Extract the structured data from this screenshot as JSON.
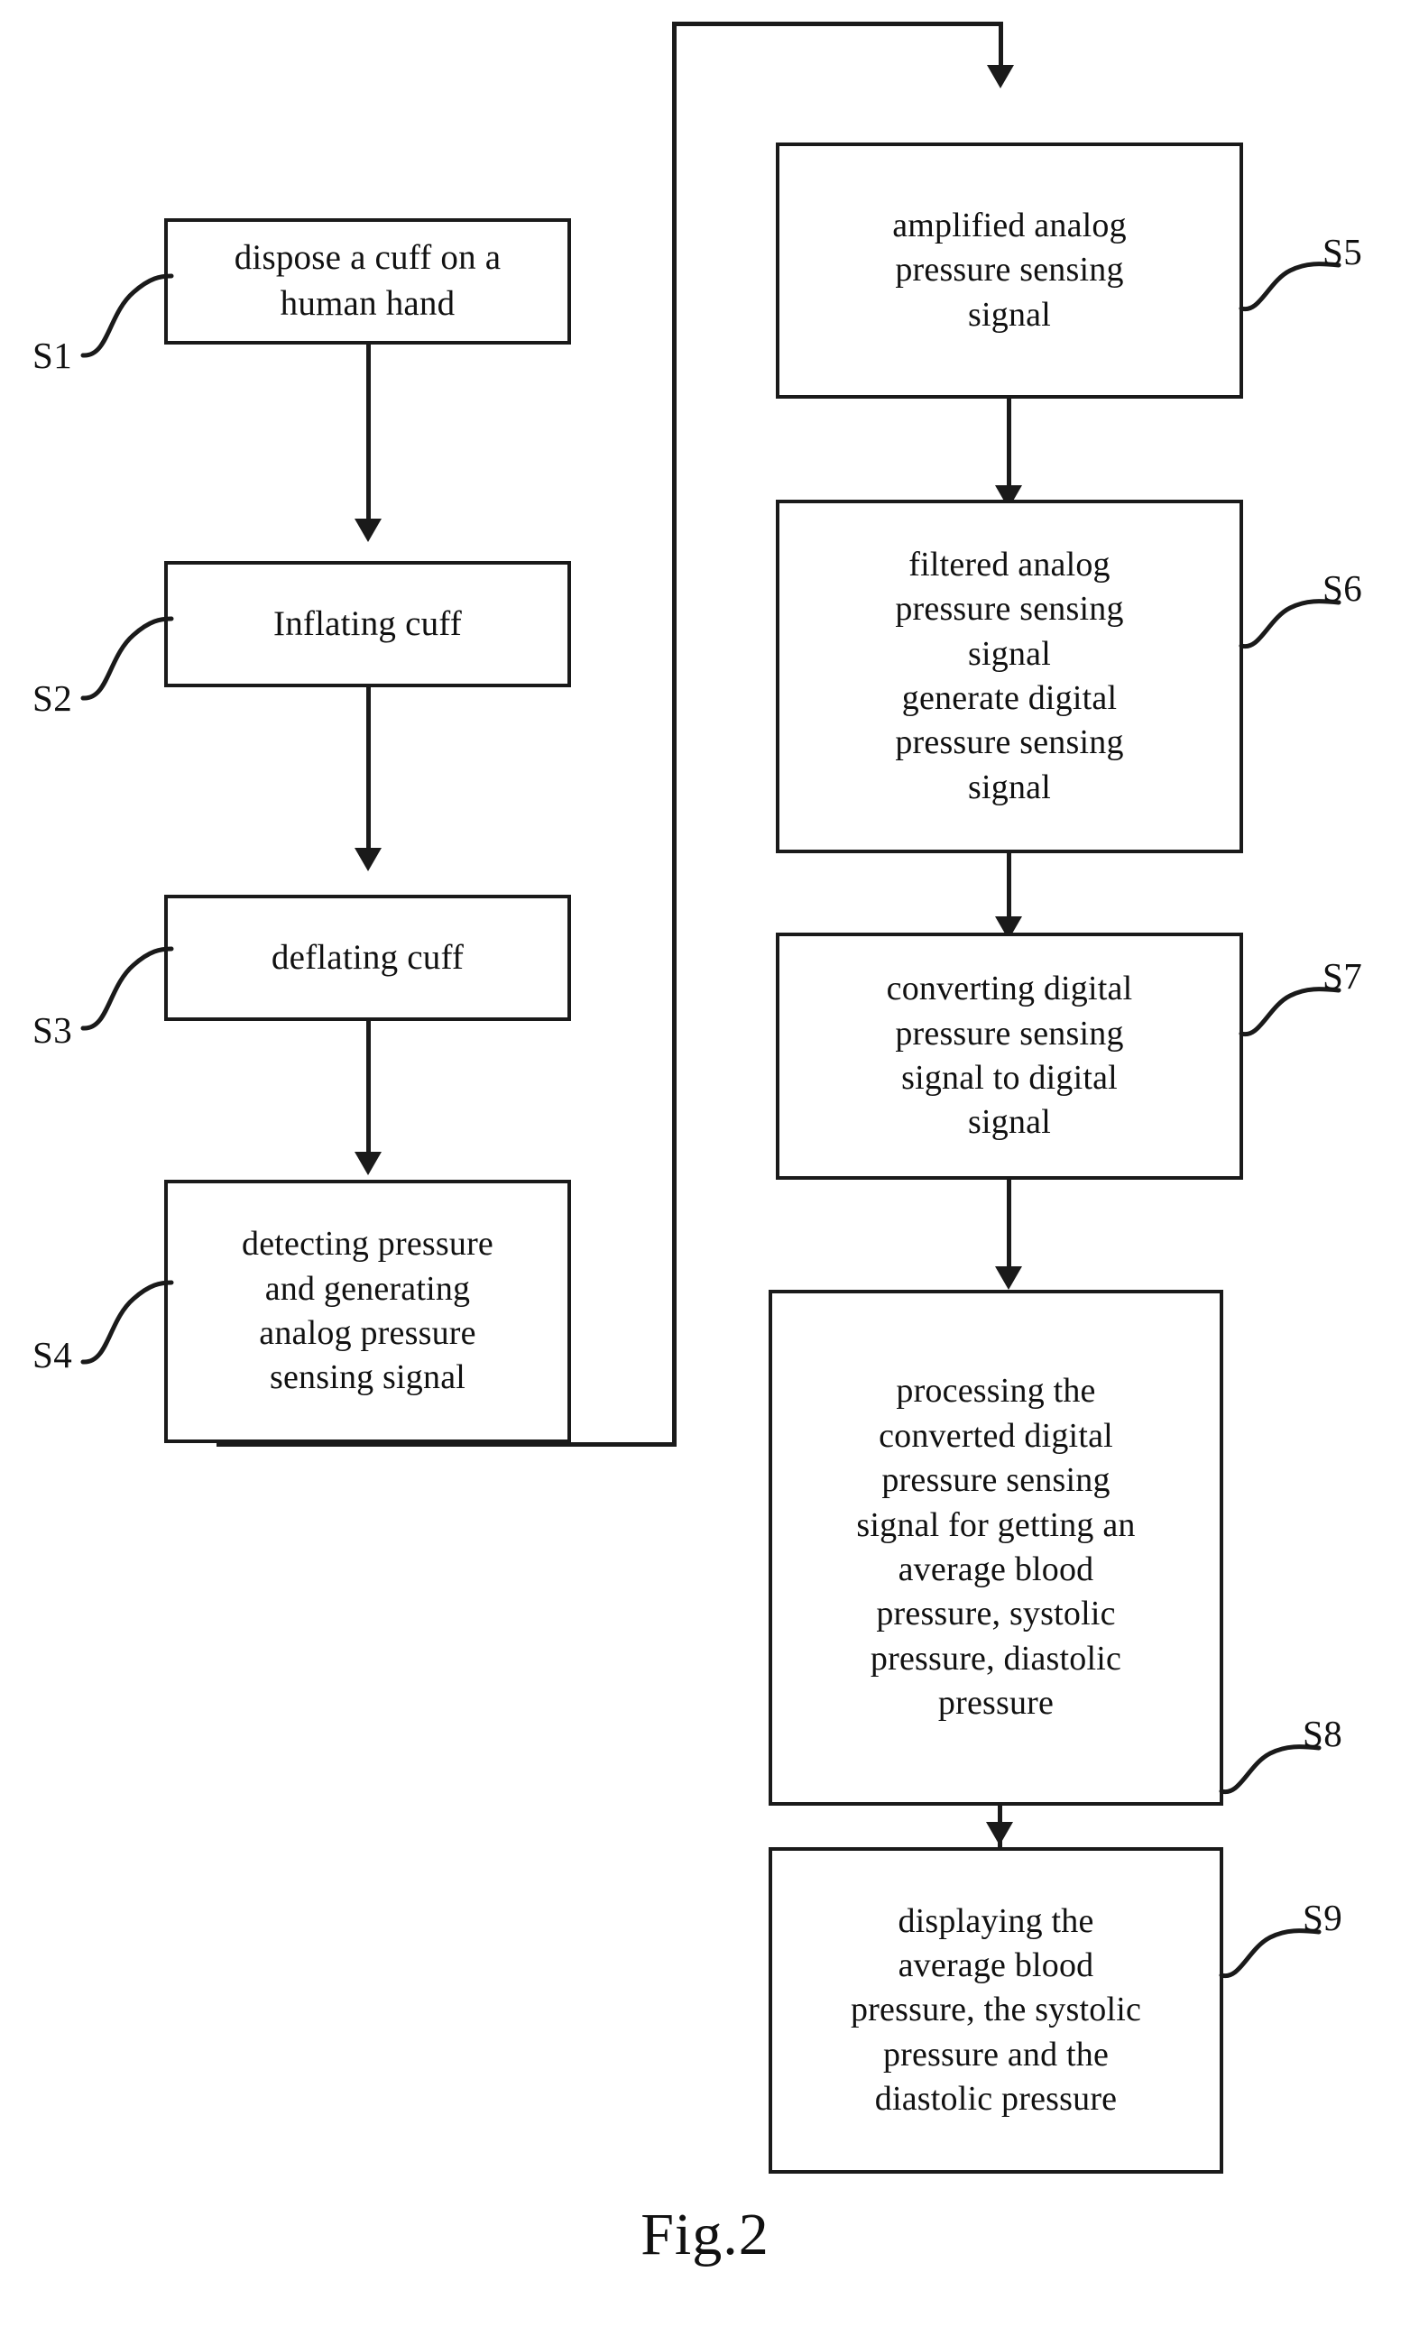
{
  "figure": {
    "caption": "Fig.2",
    "type": "patent-flowchart"
  },
  "chart_data": {
    "type": "diagram",
    "title": "Fig.2",
    "layout": "two-column flowchart with feedback loop",
    "nodes": [
      {
        "id": "S1",
        "label": "S1",
        "text": "dispose a cuff  on a\nhuman hand",
        "column": "left"
      },
      {
        "id": "S2",
        "label": "S2",
        "text": "Inflating cuff",
        "column": "left"
      },
      {
        "id": "S3",
        "label": "S3",
        "text": "deflating cuff",
        "column": "left"
      },
      {
        "id": "S4",
        "label": "S4",
        "text": "detecting  pressure\nand generating\nanalog pressure\nsensing signal",
        "column": "left"
      },
      {
        "id": "S5",
        "label": "S5",
        "text": "amplified analog\npressure sensing\nsignal",
        "column": "right"
      },
      {
        "id": "S6",
        "label": "S6",
        "text": "filtered analog\npressure sensing\nsignal\ngenerate digital\npressure sensing\nsignal",
        "column": "right"
      },
      {
        "id": "S7",
        "label": "S7",
        "text": "converting  digital\npressure sensing\nsignal  to  digital\nsignal",
        "column": "right"
      },
      {
        "id": "S8",
        "label": "S8",
        "text": "processing the\nconverted digital\npressure sensing\nsignal  for getting an\naverage blood\npressure, systolic\npressure, diastolic\npressure",
        "column": "right"
      },
      {
        "id": "S9",
        "label": "S9",
        "text": "displaying the\naverage blood\npressure, the systolic\npressure and the\ndiastolic pressure",
        "column": "right"
      }
    ],
    "edges": [
      {
        "from": "S1",
        "to": "S2",
        "style": "arrow"
      },
      {
        "from": "S2",
        "to": "S3",
        "style": "arrow"
      },
      {
        "from": "S3",
        "to": "S4",
        "style": "arrow"
      },
      {
        "from": "S4",
        "to": "S5",
        "style": "routed-arrow"
      },
      {
        "from": "S5",
        "to": "S6",
        "style": "arrow"
      },
      {
        "from": "S6",
        "to": "S7",
        "style": "arrow"
      },
      {
        "from": "S7",
        "to": "S8",
        "style": "arrow"
      },
      {
        "from": "S8",
        "to": "S9",
        "style": "arrow"
      }
    ],
    "colors": {
      "stroke": "#1a1a1a",
      "background": "#ffffff",
      "text": "#111111"
    }
  }
}
